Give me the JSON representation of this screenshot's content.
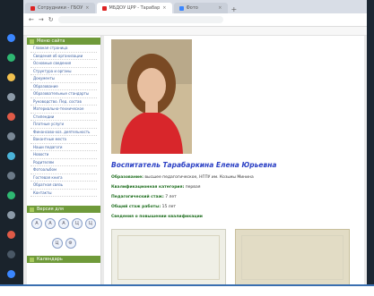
{
  "browser": {
    "tabs": [
      {
        "label": "Сотрудники - ГБОУ"
      },
      {
        "label": "МБДОУ ЦРР - Тарабар"
      },
      {
        "label": "Фото"
      }
    ],
    "url": "",
    "bookmarks": []
  },
  "sidebar": {
    "menu_header": "Меню сайта",
    "items": [
      "Главная страница",
      "Сведения об организации",
      "Основные сведения",
      "Структура и органы",
      "Документы",
      "Образование",
      "Образовательные стандарты",
      "Руководство. Пед. состав",
      "Материально-техническое",
      "Стипендии",
      "Платные услуги",
      "Финансово-хоз. деятельность",
      "Вакантные места",
      "Наши педагоги",
      "Новости",
      "Родителям",
      "Фотоальбом",
      "Гостевая книга",
      "Обратная связь",
      "Контакты"
    ],
    "version_header": "Версия для",
    "vision_buttons": [
      "А",
      "А",
      "А",
      "Ц",
      "Ц",
      "Ц",
      "⚙"
    ],
    "footer_header": "Календарь"
  },
  "main": {
    "title": "Воспитатель Тарабаркина Елена Юрьевна",
    "info": [
      {
        "label": "Образование:",
        "value": "высшее педагогическое, НГПУ им. Козьмы Минина"
      },
      {
        "label": "Квалификационная категория:",
        "value": "первая"
      },
      {
        "label": "Педагогический стаж:",
        "value": "7 лет"
      },
      {
        "label": "Общий стаж работы:",
        "value": "15 лет"
      },
      {
        "label": "Сведения о повышении квалификации",
        "value": ""
      }
    ]
  },
  "colors": {
    "accent_green": "#6f9a3a",
    "title_blue": "#2a3fc4"
  }
}
